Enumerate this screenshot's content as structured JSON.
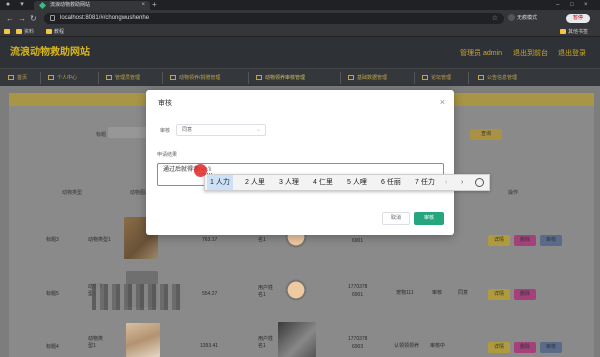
{
  "browser": {
    "tab_title": "流浪动物救助网站",
    "url": "localhost:8081/#/chongwushenhe",
    "incognito_label": "无痕模式",
    "pause_label": "暂停",
    "bookmarks": [
      "资料",
      "教程"
    ],
    "other_bookmarks": "其他书签"
  },
  "app": {
    "site_title": "流浪动物救助网站",
    "header_links": [
      "管理员 admin",
      "退出到前台",
      "退出登录"
    ],
    "nav_items": [
      "首页",
      "个人中心",
      "管理员管理",
      "动物领养/捐赠管理",
      "动物领养审核管理",
      "基础数据管理",
      "论坛管理",
      "公告信息管理"
    ],
    "active_nav_index": 4
  },
  "page": {
    "search_label": "标题",
    "query_button": "查询",
    "columns": [
      "动物类型",
      "动物图片",
      "操作"
    ],
    "rows": [
      {
        "title": "标题3",
        "type": "动物类型1",
        "price": "763.17",
        "owner": "用户姓名1",
        "phone_a": "1770378",
        "phone_b": "6901"
      },
      {
        "title": "标题5",
        "type": "动物类型1",
        "price": "554.27",
        "owner": "用户姓名1",
        "phone_a": "1770378",
        "phone_b": "6901",
        "contact": "宠物111",
        "status": "审核",
        "result": "同意"
      },
      {
        "title": "标题4",
        "type": "动物类型1",
        "price": "1393.41",
        "owner": "用户姓名1",
        "phone_a": "1770378",
        "phone_b": "6903",
        "contact": "认领领领养",
        "status": "审核中"
      }
    ],
    "op_labels": {
      "detail": "详情",
      "delete": "删除",
      "review": "审核"
    }
  },
  "modal": {
    "title": "审核",
    "close_label": "×",
    "field_status_label": "审核",
    "status_value": "同意",
    "field_result_label": "申请结果",
    "textarea_text": "通过后就得者",
    "composing_text": "ren'li",
    "cancel_label": "取消",
    "ok_label": "审核"
  },
  "ime": {
    "candidates": [
      "1 人力",
      "2 人里",
      "3 人理",
      "4 仁里",
      "5 人哩",
      "6 任丽",
      "7 任力"
    ],
    "selected_index": 0,
    "prev": "‹",
    "next": "›"
  },
  "colors": {
    "accent_green": "#25a67e",
    "title_gold": "#d9b61e",
    "focus_blue": "#409eff",
    "cursor_red": "#e22828"
  }
}
